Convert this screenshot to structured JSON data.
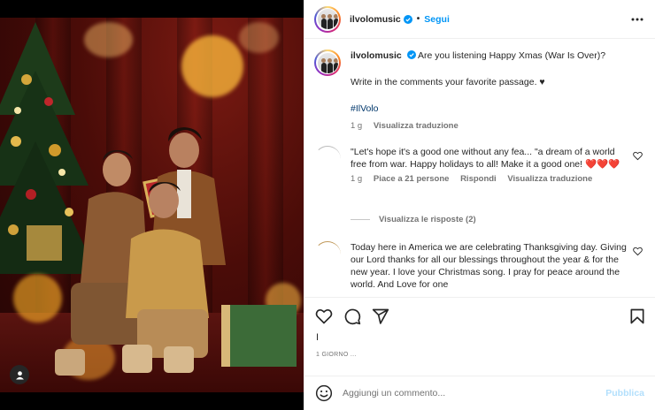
{
  "header": {
    "username": "ilvolomusic",
    "follow_label": "Segui"
  },
  "caption": {
    "username": "ilvolomusic",
    "line1": "Are you listening Happy Xmas (War Is Over)?",
    "line2": "Write in the comments your favorite passage. ♥",
    "hashtag": "#IlVolo",
    "age": "1 g",
    "translate": "Visualizza traduzione"
  },
  "comments": [
    {
      "text": "\"Let's hope it's a good one without any fea... \"a dream of a world free from war. Happy holidays to all! Make it a good one!",
      "hearts": "❤️❤️❤️",
      "age": "1 g",
      "likes": "Piace a 21 persone",
      "reply": "Rispondi",
      "translate": "Visualizza traduzione",
      "view_replies": "Visualizza le risposte (2)"
    },
    {
      "text": "Today here in America we are celebrating Thanksgiving day. Giving our Lord thanks for all our blessings throughout the year & for the new year. I love your Christmas song. I pray for peace around the world. And Love for one"
    }
  ],
  "likes_line": "I",
  "time_ago": "1 GIORNO ...",
  "add_comment": {
    "placeholder": "Aggiungi un commento...",
    "publish_label": "Pubblica"
  },
  "colors": {
    "accent": "#0095f6",
    "publish_disabled": "#b2dffc",
    "heart_red": "#d4001a"
  },
  "icons": [
    "more-options-icon",
    "verified-badge-icon",
    "heart-icon",
    "comment-icon",
    "share-icon",
    "save-icon",
    "emoji-icon",
    "user-tag-icon"
  ]
}
